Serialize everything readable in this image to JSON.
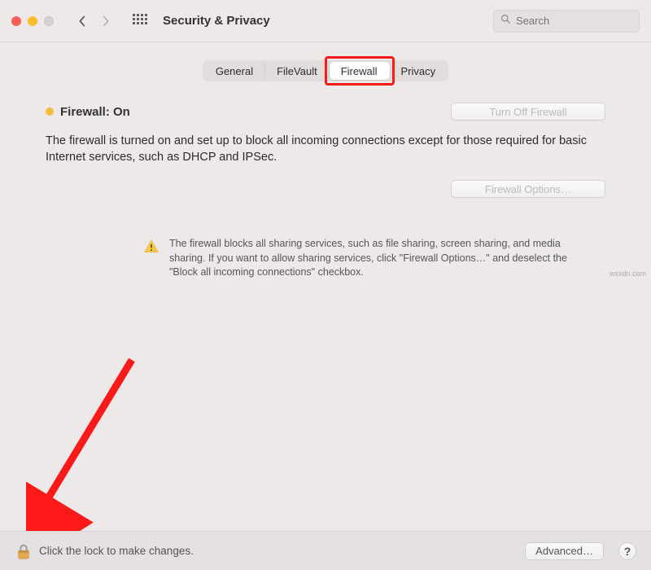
{
  "window": {
    "title": "Security & Privacy"
  },
  "search": {
    "placeholder": "Search"
  },
  "tabs": {
    "general": "General",
    "filevault": "FileVault",
    "firewall": "Firewall",
    "privacy": "Privacy",
    "active": "firewall"
  },
  "firewall": {
    "status_label": "Firewall: On",
    "turn_off_label": "Turn Off Firewall",
    "description": "The firewall is turned on and set up to block all incoming connections except for those required for basic Internet services, such as DHCP and IPSec.",
    "options_label": "Firewall Options…",
    "warning": "The firewall blocks all sharing services, such as file sharing, screen sharing, and media sharing. If you want to allow sharing services, click \"Firewall Options…\" and deselect the \"Block all incoming connections\" checkbox."
  },
  "footer": {
    "lock_text": "Click the lock to make changes.",
    "advanced_label": "Advanced…",
    "help_label": "?"
  },
  "watermark": "wsxdn.com",
  "colors": {
    "accent_red_annotation": "#ff1a1a",
    "status_dot": "#f5bc3e"
  }
}
